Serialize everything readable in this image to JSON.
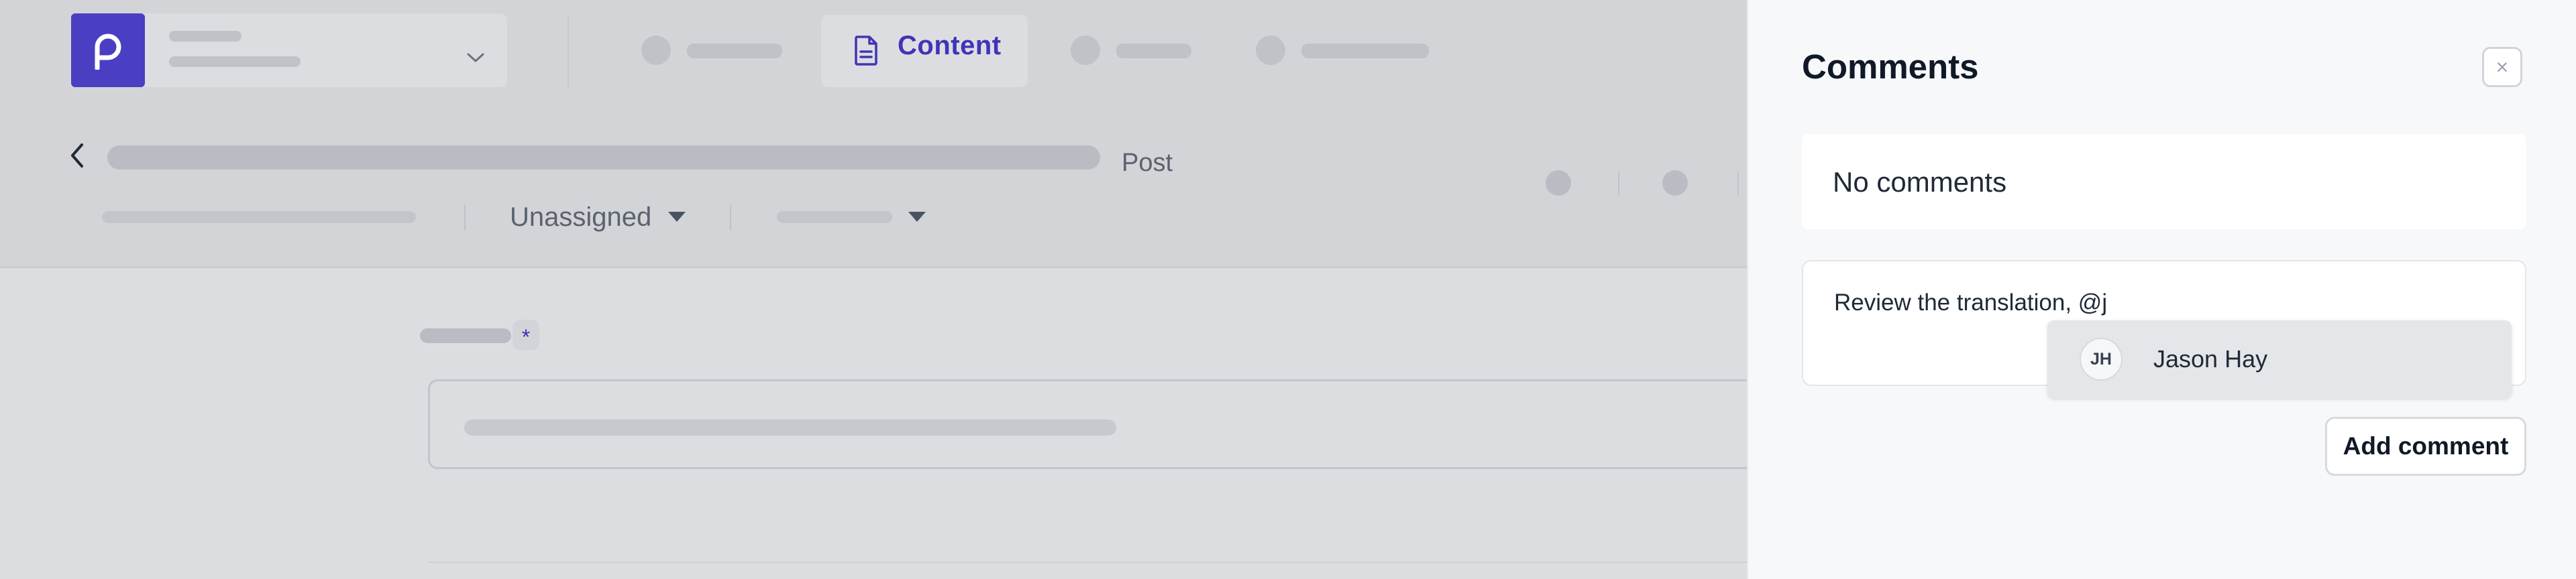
{
  "topnav": {
    "active_tab_label": "Content"
  },
  "header": {
    "post_type_label": "Post",
    "assignee_label": "Unassigned"
  },
  "field": {
    "required_marker": "*"
  },
  "comments_panel": {
    "title": "Comments",
    "close_icon": "×",
    "empty_text": "No comments",
    "draft_text": "Review the translation, @j",
    "mention_suggestions": [
      {
        "initials": "JH",
        "name": "Jason Hay"
      }
    ],
    "add_button_label": "Add comment"
  },
  "colors": {
    "brand": "#4a3fc2",
    "accent_text": "#4034b8",
    "overlay": "#dcdde0",
    "panel_bg": "#f7f8fa"
  },
  "icons": [
    "p-logo-icon",
    "chevron-down-icon",
    "document-icon",
    "back-arrow-icon",
    "caret-down-icon",
    "close-icon"
  ]
}
